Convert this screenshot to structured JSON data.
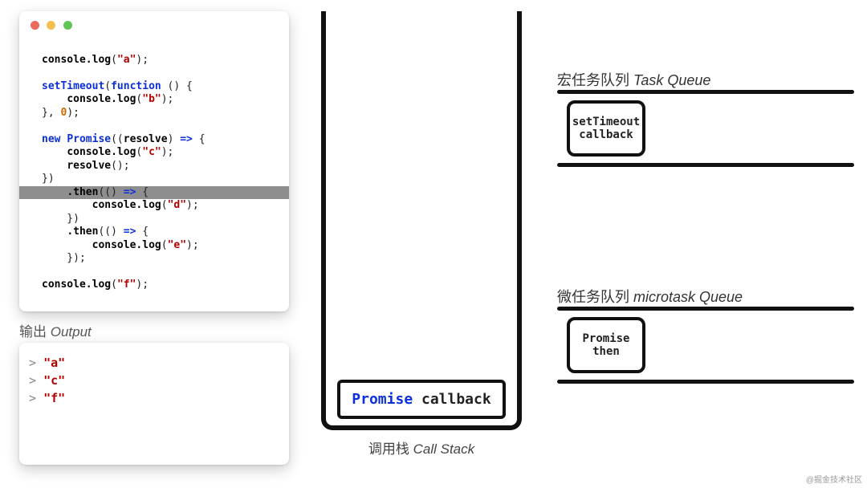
{
  "colors": {
    "dot_red": "#ec6a5e",
    "dot_yellow": "#f5bf4f",
    "dot_green": "#61c554"
  },
  "editor": {
    "code_lines": [
      "",
      "console.log(\"a\");",
      "",
      "setTimeout(function () {",
      "    console.log(\"b\");",
      "}, 0);",
      "",
      "new Promise((resolve) => {",
      "    console.log(\"c\");",
      "    resolve();",
      "})",
      "    .then(() => {",
      "        console.log(\"d\");",
      "    })",
      "    .then(() => {",
      "        console.log(\"e\");",
      "    });",
      "",
      "console.log(\"f\");"
    ],
    "highlight_line_index": 11
  },
  "output": {
    "label_cn": "输出",
    "label_en": "Output",
    "lines": [
      "\"a\"",
      "\"c\"",
      "\"f\""
    ]
  },
  "call_stack": {
    "label_cn": "调用栈",
    "label_en": "Call Stack",
    "frames": [
      {
        "lhs": "Promise",
        "rhs": " callback"
      }
    ]
  },
  "task_queue": {
    "title_cn": "宏任务队列",
    "title_en": "Task Queue",
    "items": [
      "setTimeout\ncallback"
    ]
  },
  "microtask_queue": {
    "title_cn": "微任务队列",
    "title_en": "microtask Queue",
    "items": [
      "Promise\nthen"
    ]
  },
  "watermark": "@掘金技术社区"
}
